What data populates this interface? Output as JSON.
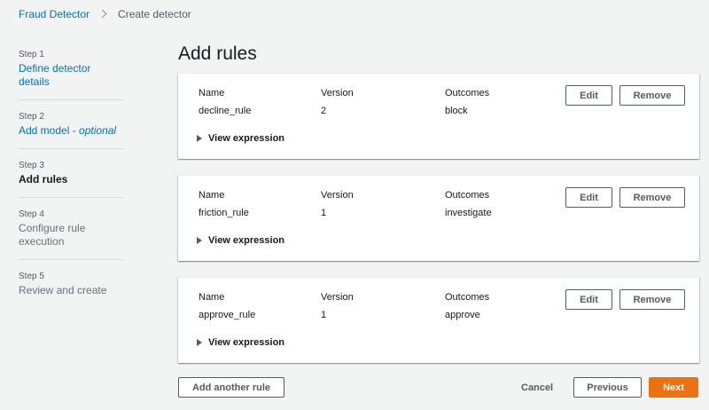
{
  "breadcrumb": {
    "root": "Fraud Detector",
    "current": "Create detector"
  },
  "steps": [
    {
      "num": "Step 1",
      "label": "Define detector details",
      "state": "link"
    },
    {
      "num": "Step 2",
      "label": "Add model - ",
      "label_optional": "optional",
      "state": "link"
    },
    {
      "num": "Step 3",
      "label": "Add rules",
      "state": "current"
    },
    {
      "num": "Step 4",
      "label": "Configure rule execution",
      "state": "disabled"
    },
    {
      "num": "Step 5",
      "label": "Review and create",
      "state": "disabled"
    }
  ],
  "page_title": "Add rules",
  "columns": {
    "name": "Name",
    "version": "Version",
    "outcomes": "Outcomes"
  },
  "rules": [
    {
      "name": "decline_rule",
      "version": "2",
      "outcomes": "block"
    },
    {
      "name": "friction_rule",
      "version": "1",
      "outcomes": "investigate"
    },
    {
      "name": "approve_rule",
      "version": "1",
      "outcomes": "approve"
    }
  ],
  "labels": {
    "view_expression": "View expression",
    "edit": "Edit",
    "remove": "Remove",
    "add_another_rule": "Add another rule",
    "cancel": "Cancel",
    "previous": "Previous",
    "next": "Next"
  },
  "colors": {
    "primary": "#ec7211",
    "link": "#0073bb",
    "background": "#f2f3f3"
  }
}
